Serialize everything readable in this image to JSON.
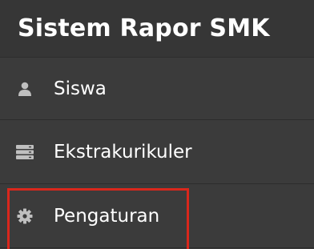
{
  "header": {
    "title": "Sistem Rapor SMK"
  },
  "nav": {
    "items": [
      {
        "label": "Siswa",
        "icon": "user-icon"
      },
      {
        "label": "Ekstrakurikuler",
        "icon": "server-icon"
      },
      {
        "label": "Pengaturan",
        "icon": "gear-icon"
      }
    ]
  },
  "colors": {
    "sidebar_bg": "#3b3b3b",
    "header_bg": "#363636",
    "text": "#ffffff",
    "icon": "#bfbfbf",
    "highlight": "#d9271c"
  }
}
